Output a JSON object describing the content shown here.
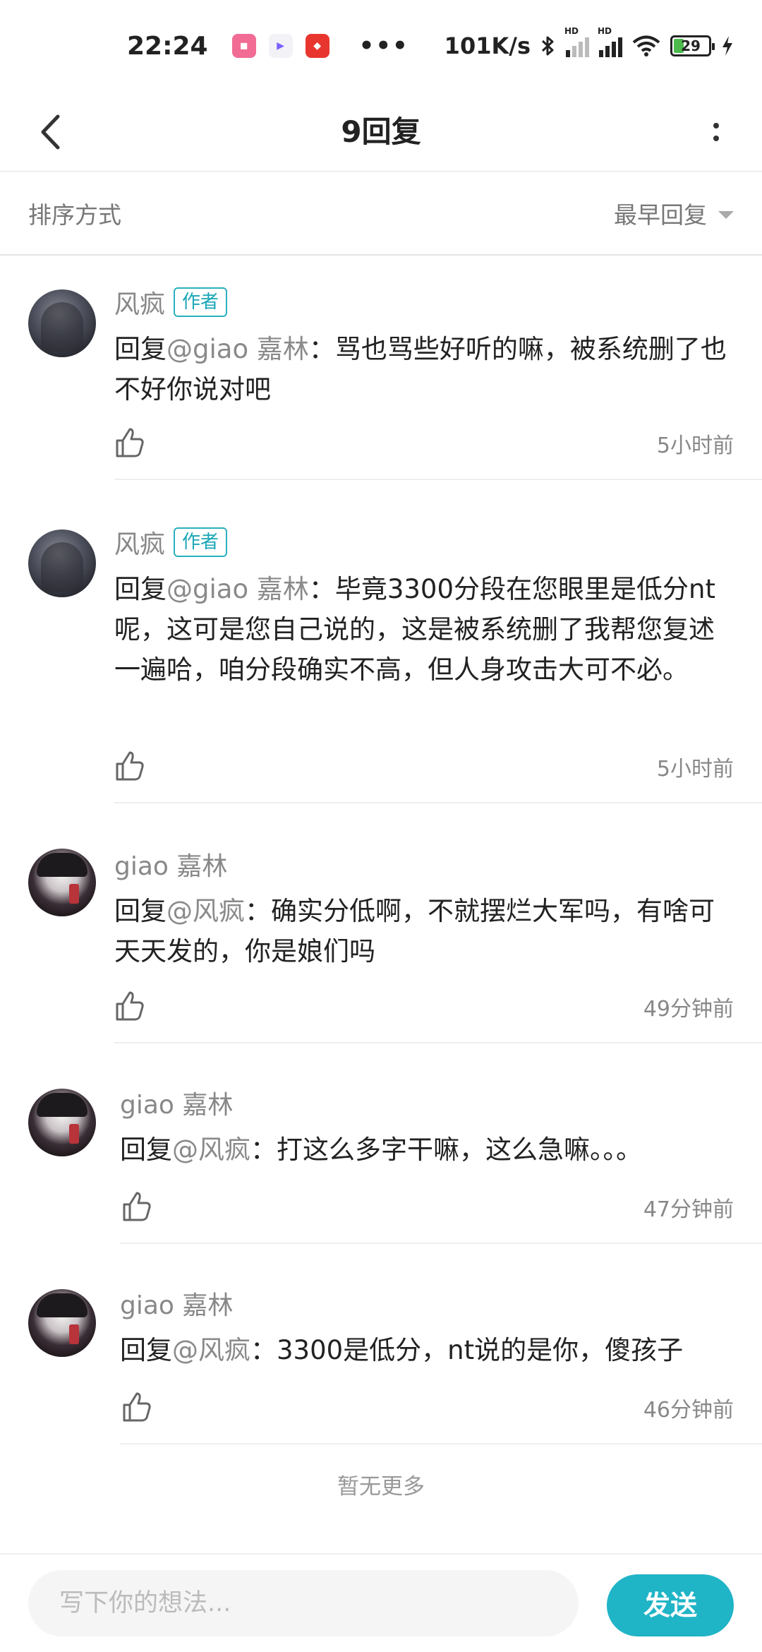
{
  "status_bar": {
    "time": "22:24",
    "app_icons": [
      "bilibili-app-icon",
      "play-app-icon",
      "red-app-icon"
    ],
    "network_speed": "101K/s",
    "battery": "29",
    "hd_label": "HD"
  },
  "header": {
    "title": "9回复"
  },
  "sort": {
    "label": "排序方式",
    "value": "最早回复"
  },
  "comments": [
    {
      "author": "风疯",
      "tag": "作者",
      "prefix": "回复",
      "mention": "@giao 嘉林",
      "body": "：骂也骂些好听的嘛，被系统删了也不好你说对吧",
      "time": "5小时前"
    },
    {
      "author": "风疯",
      "tag": "作者",
      "prefix": "回复",
      "mention": "@giao 嘉林",
      "body": "：毕竟3300分段在您眼里是低分nt呢，这可是您自己说的，这是被系统删了我帮您复述一遍哈，咱分段确实不高，但人身攻击大可不必。",
      "time": "5小时前"
    },
    {
      "author": "giao 嘉林",
      "prefix": "回复",
      "mention": "@风疯",
      "body": "：确实分低啊，不就摆烂大军吗，有啥可天天发的，你是娘们吗",
      "time": "49分钟前"
    },
    {
      "author": "giao 嘉林",
      "prefix": "回复",
      "mention": "@风疯",
      "body": "：打这么多字干嘛，这么急嘛。。。",
      "time": "47分钟前"
    },
    {
      "author": "giao 嘉林",
      "prefix": "回复",
      "mention": "@风疯",
      "body": "：3300是低分，nt说的是你，傻孩子",
      "time": "46分钟前"
    }
  ],
  "footer_note": "暂无更多",
  "input": {
    "placeholder": "写下你的想法..."
  },
  "send_label": "发送",
  "colors": {
    "accent": "#1fb4c6",
    "author_tag": "#1aa6b7",
    "muted_text": "#888888"
  }
}
